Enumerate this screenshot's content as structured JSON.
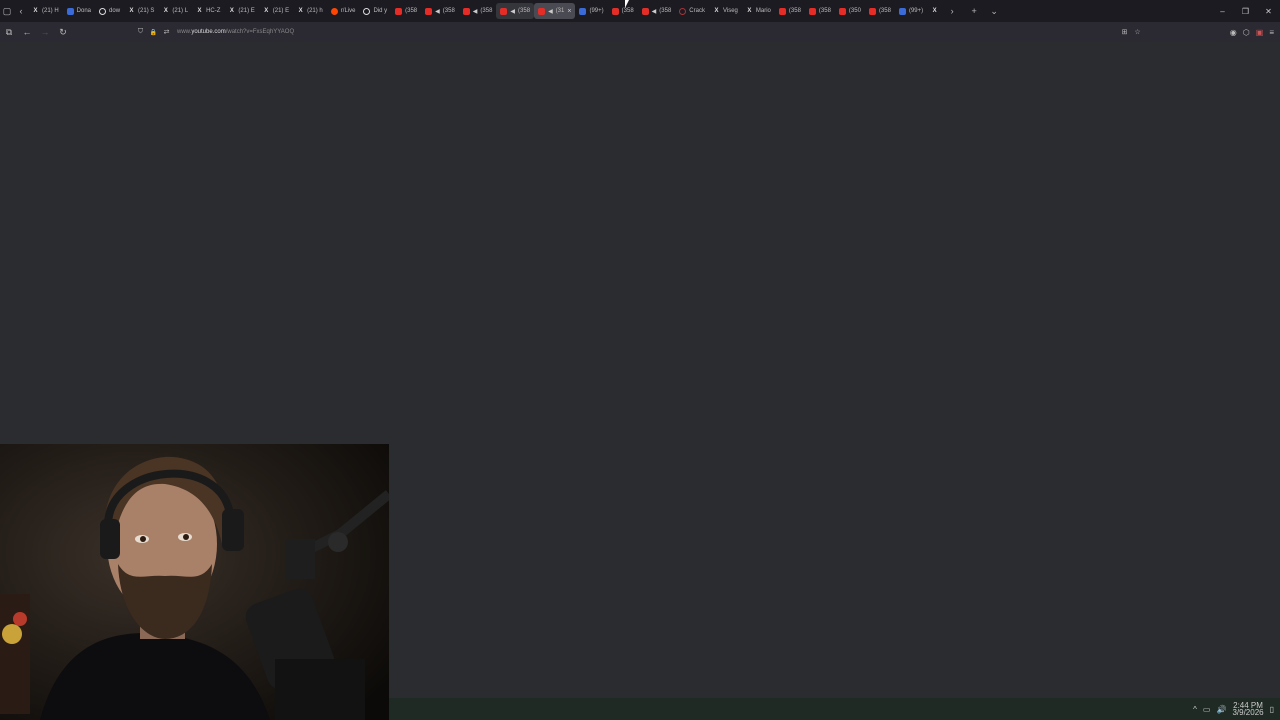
{
  "tabs": [
    {
      "icon": "x",
      "label": "(21) H"
    },
    {
      "icon": "tw",
      "label": "Dona"
    },
    {
      "icon": "g",
      "label": "dow"
    },
    {
      "icon": "x",
      "label": "(21) S"
    },
    {
      "icon": "x",
      "label": "(21) L"
    },
    {
      "icon": "x",
      "label": "HC-Z"
    },
    {
      "icon": "x",
      "label": "(21) E"
    },
    {
      "icon": "x",
      "label": "(21) E"
    },
    {
      "icon": "x",
      "label": "(21) h"
    },
    {
      "icon": "rd",
      "label": "r/Live"
    },
    {
      "icon": "g",
      "label": "Did y"
    },
    {
      "icon": "yt",
      "label": "(358"
    },
    {
      "icon": "yt",
      "speaker": true,
      "label": "(358"
    },
    {
      "icon": "yt",
      "speaker": true,
      "label": "(358"
    },
    {
      "icon": "yt",
      "speaker": true,
      "label": "(358",
      "state": "hover"
    },
    {
      "icon": "yt",
      "speaker": true,
      "label": "(31",
      "state": "active",
      "close": "×"
    },
    {
      "icon": "tw",
      "label": "(99+)"
    },
    {
      "icon": "yt",
      "label": "(358"
    },
    {
      "icon": "yt",
      "speaker": true,
      "label": "(358"
    },
    {
      "icon": "tr",
      "label": "Crack"
    },
    {
      "icon": "x",
      "label": "Viseg"
    },
    {
      "icon": "x",
      "label": "Mario"
    },
    {
      "icon": "yt",
      "label": "(358"
    },
    {
      "icon": "yt",
      "label": "(358"
    },
    {
      "icon": "yt",
      "label": "(350"
    },
    {
      "icon": "yt",
      "label": "(358"
    },
    {
      "icon": "tw",
      "label": "(99+)"
    },
    {
      "icon": "x",
      "label": ""
    }
  ],
  "tabbar": {
    "tab_overview_icon": "▢",
    "scroll_left": "‹",
    "scroll_right": "›",
    "new_tab": "+",
    "list_all_tabs": "⌄"
  },
  "window_controls": {
    "minimize": "–",
    "restore": "❐",
    "close": "✕"
  },
  "navbar": {
    "sidebar": "⧉",
    "back": "←",
    "forward": "→",
    "reload": "↻"
  },
  "url": {
    "prefix": "www.",
    "domain": "youtube.com",
    "path": "/watch?v=FxsEqhYYAOQ"
  },
  "urlbar_icons": {
    "shield": "⛉",
    "lock": "🔒",
    "perms": "⇄",
    "bookmark_page": "⊞",
    "star": "☆"
  },
  "toolbar_right": {
    "account": "◉",
    "extensions": "⬡",
    "profile": "▣",
    "menu": "≡"
  },
  "tray": {
    "chevron": "^",
    "network": "▭",
    "volume": "🔊",
    "notification": "▯"
  },
  "clock": {
    "time": "2:44 PM",
    "date": "3/9/2026"
  }
}
